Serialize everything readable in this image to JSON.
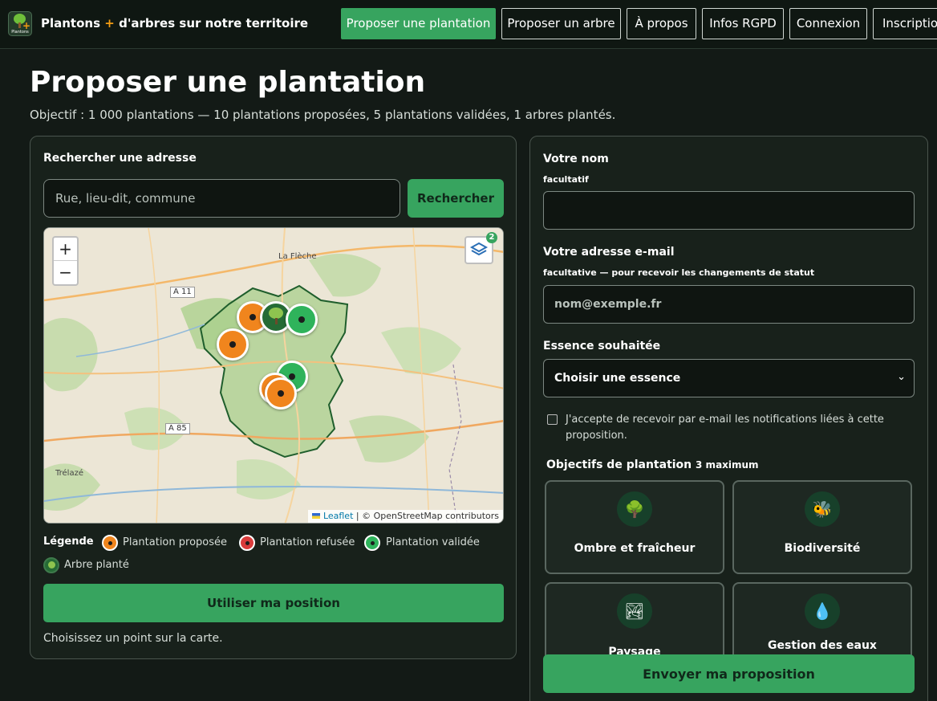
{
  "header": {
    "logo_text": "Plantons",
    "title_prefix": "Plantons",
    "title_plus": "+",
    "title_suffix": "d'arbres sur notre territoire",
    "nav": [
      {
        "label": "Proposer une plantation",
        "active": true
      },
      {
        "label": "Proposer un arbre",
        "active": false
      },
      {
        "label": "À propos",
        "active": false
      },
      {
        "label": "Infos RGPD",
        "active": false
      },
      {
        "label": "Connexion",
        "active": false
      },
      {
        "label": "Inscription",
        "active": false
      }
    ]
  },
  "page": {
    "title": "Proposer une plantation",
    "subtitle": "Objectif : 1 000 plantations — 10 plantations proposées, 5 plantations validées, 1 arbres plantés."
  },
  "search": {
    "label": "Rechercher une adresse",
    "placeholder": "Rue, lieu-dit, commune",
    "button": "Rechercher"
  },
  "map": {
    "zoom_in": "+",
    "zoom_out": "−",
    "layers_badge": "2",
    "labels": {
      "la_fleche": "La Flèche",
      "trelaze": "Trélazé"
    },
    "roads": {
      "a11": "A 11",
      "a85": "A 85"
    },
    "attribution_leaflet": "Leaflet",
    "attribution_rest": " | © OpenStreetMap contributors",
    "colors": {
      "proposed": "#f0851d",
      "refused": "#d93b3b",
      "validated": "#2fb35b",
      "planted": "#256b35"
    }
  },
  "legend": {
    "title": "Légende",
    "proposed": "Plantation proposée",
    "refused": "Plantation refusée",
    "validated": "Plantation validée",
    "planted": "Arbre planté"
  },
  "actions": {
    "use_position": "Utiliser ma position",
    "hint": "Choisissez un point sur la carte."
  },
  "form": {
    "name_label": "Votre nom",
    "name_sub": "facultatif",
    "email_label": "Votre adresse e-mail",
    "email_sub": "facultative — pour recevoir les changements de statut",
    "email_placeholder": "nom@exemple.fr",
    "species_label": "Essence souhaitée",
    "species_value": "Choisir une essence",
    "consent": "J'accepte de recevoir par e-mail les notifications liées à cette proposition.",
    "objectives_title": "Objectifs de plantation",
    "objectives_max": "3 maximum",
    "objectives": [
      {
        "label": "Ombre et fraîcheur",
        "icon": "tree-icon",
        "glyph": "🌳"
      },
      {
        "label": "Biodiversité",
        "icon": "bee-icon",
        "glyph": "🐝"
      },
      {
        "label": "Paysage",
        "icon": "landscape-icon",
        "glyph": "🏞"
      },
      {
        "label": "Gestion des eaux",
        "icon": "water-drop-icon",
        "glyph": "💧"
      }
    ],
    "submit": "Envoyer ma proposition"
  }
}
